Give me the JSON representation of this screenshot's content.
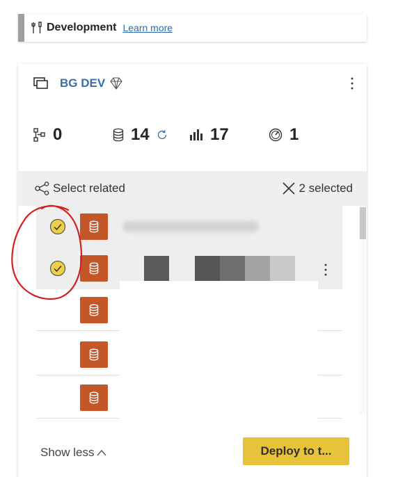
{
  "stage": {
    "title": "Development",
    "learn_more": "Learn more",
    "accent_color": "#a19f9d"
  },
  "workspace": {
    "name": "BG DEV",
    "icon": "workspace-stack-icon",
    "premium_icon": "diamond-icon",
    "name_color": "#3b6ea5"
  },
  "counts": [
    {
      "icon": "dataflow-icon",
      "value": "0"
    },
    {
      "icon": "dataset-icon",
      "value": "14"
    },
    {
      "icon": "report-icon",
      "value": "17"
    },
    {
      "icon": "dashboard-icon",
      "value": "1"
    }
  ],
  "selection_bar": {
    "select_related": "Select related",
    "selected_count": "2 selected"
  },
  "items": [
    {
      "selected": true,
      "type": "dataset"
    },
    {
      "selected": true,
      "type": "dataset"
    },
    {
      "selected": false,
      "type": "dataset"
    },
    {
      "selected": false,
      "type": "dataset"
    },
    {
      "selected": false,
      "type": "dataset"
    }
  ],
  "footer": {
    "show_less": "Show less",
    "deploy": "Deploy to t..."
  },
  "colors": {
    "dataset_tile": "#c4572a",
    "check_fill": "#f0cf45",
    "deploy_button": "#e6c33b",
    "annotation_circle": "#d42020"
  }
}
